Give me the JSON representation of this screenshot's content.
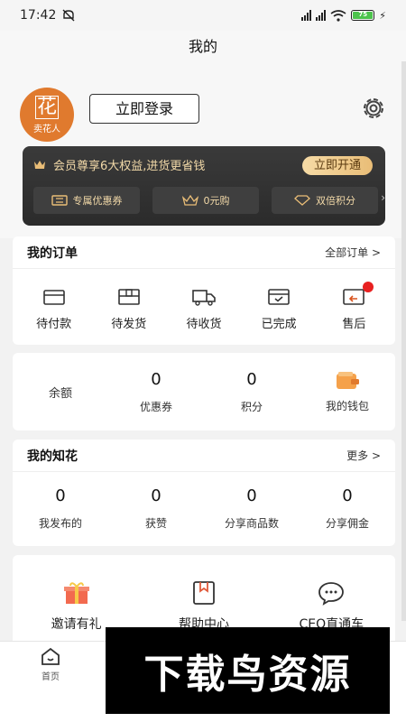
{
  "status": {
    "time": "17:42",
    "battery": "75"
  },
  "nav": {
    "title": "我的"
  },
  "profile": {
    "avatar_text_big": "花",
    "avatar_text_small": "卖花人",
    "login_label": "立即登录"
  },
  "vip": {
    "text": "会员尊享6大权益,进货更省钱",
    "open_label": "立即开通",
    "items": [
      {
        "label": "专属优惠券",
        "icon": "ticket-icon"
      },
      {
        "label": "0元购",
        "icon": "crown-icon"
      },
      {
        "label": "双倍积分",
        "icon": "diamond-icon"
      }
    ]
  },
  "orders": {
    "title": "我的订单",
    "all_label": "全部订单 >",
    "items": [
      {
        "label": "待付款",
        "icon": "card-icon"
      },
      {
        "label": "待发货",
        "icon": "package-icon"
      },
      {
        "label": "待收货",
        "icon": "truck-icon"
      },
      {
        "label": "已完成",
        "icon": "check-box-icon"
      },
      {
        "label": "售后",
        "icon": "return-icon"
      }
    ]
  },
  "wallet": {
    "balance_label": "余额",
    "stats": [
      {
        "value": "0",
        "label": "优惠券"
      },
      {
        "value": "0",
        "label": "积分"
      }
    ],
    "wallet_label": "我的钱包"
  },
  "zhihua": {
    "title": "我的知花",
    "more_label": "更多 >",
    "stats": [
      {
        "value": "0",
        "label": "我发布的"
      },
      {
        "value": "0",
        "label": "获赞"
      },
      {
        "value": "0",
        "label": "分享商品数"
      },
      {
        "value": "0",
        "label": "分享佣金"
      }
    ]
  },
  "tools": [
    {
      "label": "邀请有礼",
      "icon": "gift-icon"
    },
    {
      "label": "帮助中心",
      "icon": "bookmark-icon"
    },
    {
      "label": "CEO直通车",
      "icon": "chat-icon"
    }
  ],
  "tabbar": {
    "home_label": "首页"
  },
  "watermark": "下载鸟资源",
  "colors": {
    "accent": "#e07a2e",
    "vip_gold": "#f2d9a8",
    "dark": "#2b2b2b"
  }
}
